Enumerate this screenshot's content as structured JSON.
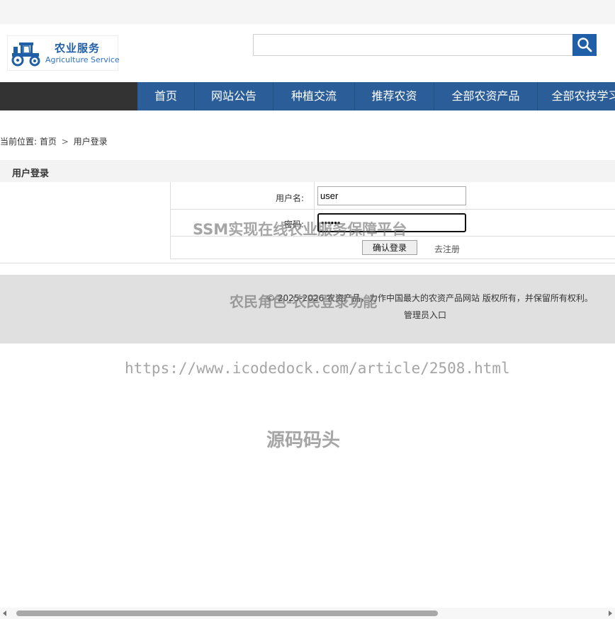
{
  "logo": {
    "title": "农业服务",
    "subtitle": "Agriculture Service"
  },
  "search": {
    "value": "",
    "placeholder": ""
  },
  "nav": [
    {
      "label": "首页"
    },
    {
      "label": "网站公告"
    },
    {
      "label": "种植交流"
    },
    {
      "label": "推荐农资"
    },
    {
      "label": "全部农资产品"
    },
    {
      "label": "全部农技学习"
    }
  ],
  "breadcrumb": {
    "prefix": "当前位置:",
    "home": "首页",
    "separator": ">",
    "current": "用户登录"
  },
  "section": {
    "title": "用户登录"
  },
  "login": {
    "username_label": "用户名:",
    "username_value": "user",
    "password_label": "密码:",
    "password_value": "••••••",
    "submit_label": "确认登录",
    "register_label": "去注册"
  },
  "footer": {
    "copyright": "© 2025-2026 农资产品，力作中国最大的农资产品网站 版权所有，并保留所有权利。",
    "admin_link": "管理员入口"
  },
  "watermarks": {
    "line1": "SSM实现在线农业服务保障平台",
    "line2": "农民角色-农民登录功能",
    "line3": "https://www.icodedock.com/article/2508.html",
    "line4": "源码码头"
  },
  "colors": {
    "nav_blue": "#2b5e99",
    "nav_dark": "#333333",
    "brand_blue": "#1f5fa8",
    "footer_bg": "#e0e0e0"
  }
}
